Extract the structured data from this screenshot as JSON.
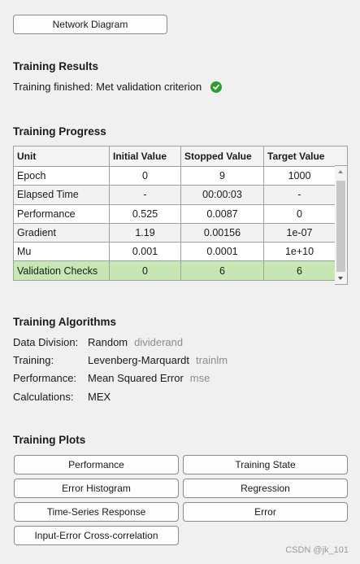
{
  "top": {
    "network_diagram_label": "Network Diagram"
  },
  "results": {
    "title": "Training Results",
    "status_text": "Training finished: Met validation criterion",
    "status_icon": "check-circle-icon",
    "status_color": "#2aa02a"
  },
  "progress": {
    "title": "Training Progress",
    "headers": [
      "Unit",
      "Initial Value",
      "Stopped Value",
      "Target Value"
    ],
    "rows": [
      {
        "unit": "Epoch",
        "initial": "0",
        "stopped": "9",
        "target": "1000"
      },
      {
        "unit": "Elapsed Time",
        "initial": "-",
        "stopped": "00:00:03",
        "target": "-"
      },
      {
        "unit": "Performance",
        "initial": "0.525",
        "stopped": "0.0087",
        "target": "0"
      },
      {
        "unit": "Gradient",
        "initial": "1.19",
        "stopped": "0.00156",
        "target": "1e-07"
      },
      {
        "unit": "Mu",
        "initial": "0.001",
        "stopped": "0.0001",
        "target": "1e+10"
      },
      {
        "unit": "Validation Checks",
        "initial": "0",
        "stopped": "6",
        "target": "6"
      }
    ],
    "highlight_color": "#c6e6b4"
  },
  "algorithms": {
    "title": "Training Algorithms",
    "items": [
      {
        "label": "Data Division:",
        "value": "Random",
        "fn": "dividerand"
      },
      {
        "label": "Training:",
        "value": "Levenberg-Marquardt",
        "fn": "trainlm"
      },
      {
        "label": "Performance:",
        "value": "Mean Squared Error",
        "fn": "mse"
      },
      {
        "label": "Calculations:",
        "value": "MEX",
        "fn": ""
      }
    ]
  },
  "plots": {
    "title": "Training Plots",
    "buttons": {
      "performance": "Performance",
      "training_state": "Training State",
      "error_histogram": "Error Histogram",
      "regression": "Regression",
      "time_series": "Time-Series Response",
      "error": "Error",
      "input_error": "Input-Error Cross-correlation"
    }
  },
  "watermark": "CSDN @jk_101"
}
